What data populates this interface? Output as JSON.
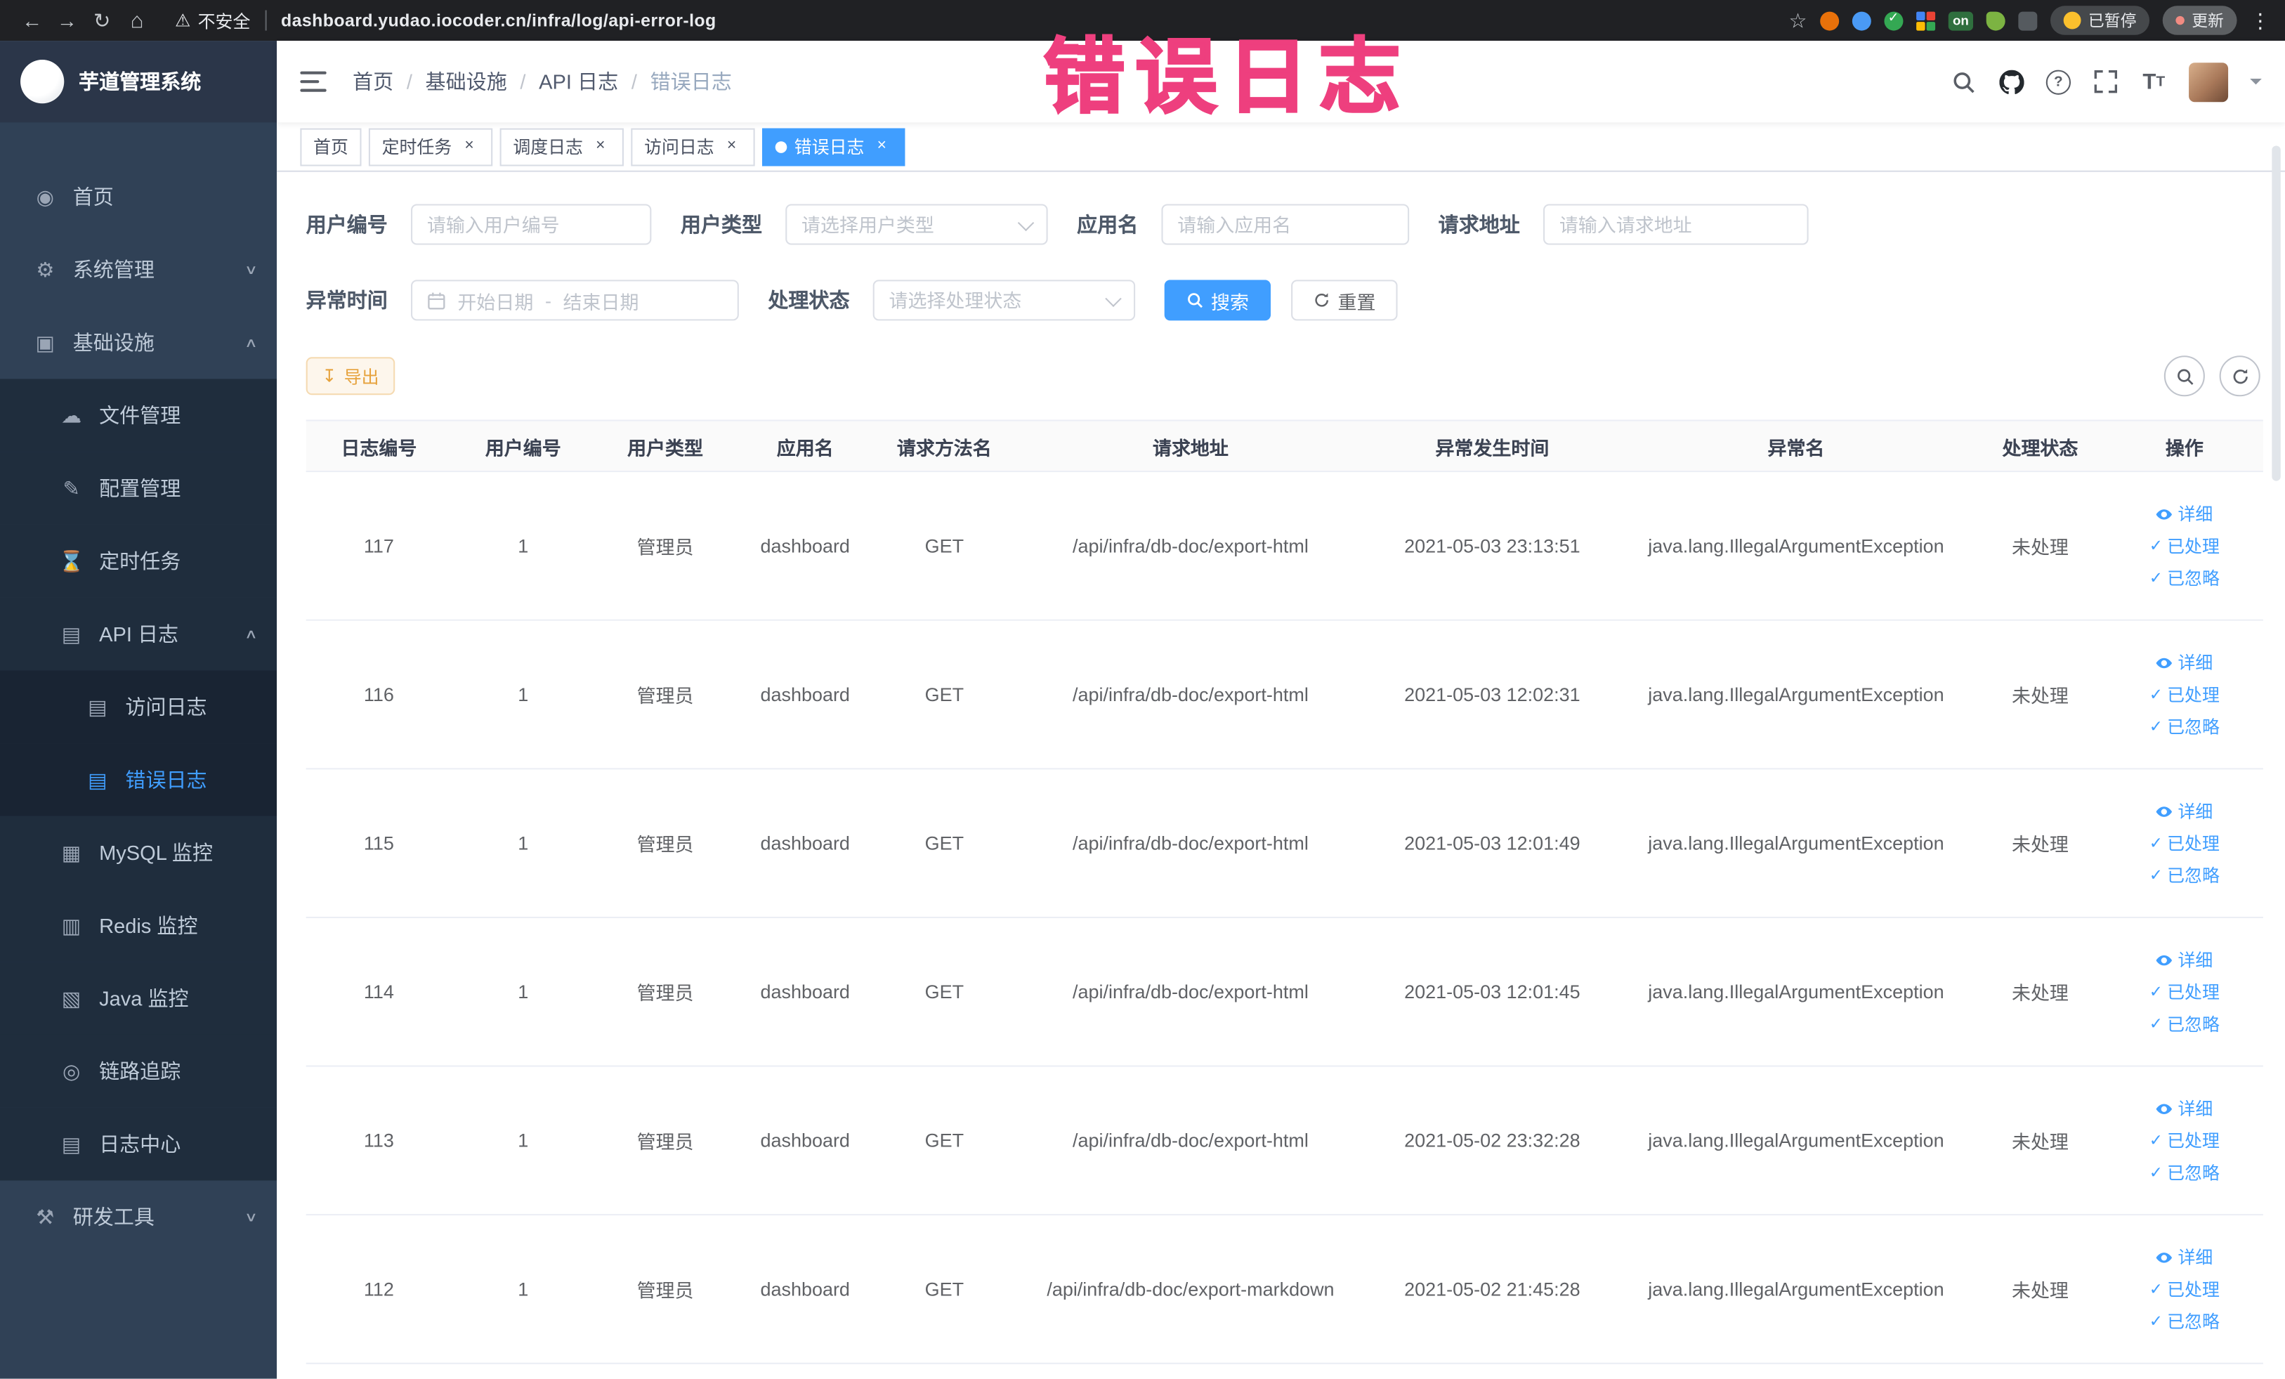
{
  "browser": {
    "security_label": "不安全",
    "url": "dashboard.yudao.iocoder.cn/infra/log/api-error-log",
    "paused_label": "已暂停",
    "update_label": "更新",
    "extension_on_badge": "on"
  },
  "annotation": {
    "text": "错误日志",
    "color": "#ee3f7e"
  },
  "sidebar": {
    "logo_title": "芋道管理系统",
    "menu": [
      {
        "key": "home",
        "label": "首页",
        "icon": "dashboard-icon",
        "level": 0
      },
      {
        "key": "system",
        "label": "系统管理",
        "icon": "gear-icon",
        "level": 0,
        "expand": "down"
      },
      {
        "key": "infra",
        "label": "基础设施",
        "icon": "infra-icon",
        "level": 0,
        "expand": "up"
      },
      {
        "key": "file",
        "label": "文件管理",
        "icon": "file-icon",
        "level": 1
      },
      {
        "key": "config",
        "label": "配置管理",
        "icon": "config-icon",
        "level": 1
      },
      {
        "key": "job",
        "label": "定时任务",
        "icon": "job-icon",
        "level": 1
      },
      {
        "key": "api-log",
        "label": "API 日志",
        "icon": "api-log-icon",
        "level": 1,
        "expand": "up"
      },
      {
        "key": "access-log",
        "label": "访问日志",
        "icon": "access-log-icon",
        "level": 2
      },
      {
        "key": "error-log",
        "label": "错误日志",
        "icon": "error-log-icon",
        "level": 2,
        "active": true
      },
      {
        "key": "mysql",
        "label": "MySQL 监控",
        "icon": "mysql-icon",
        "level": 1
      },
      {
        "key": "redis",
        "label": "Redis 监控",
        "icon": "redis-icon",
        "level": 1
      },
      {
        "key": "java",
        "label": "Java 监控",
        "icon": "java-icon",
        "level": 1
      },
      {
        "key": "trace",
        "label": "链路追踪",
        "icon": "trace-icon",
        "level": 1
      },
      {
        "key": "log-center",
        "label": "日志中心",
        "icon": "log-center-icon",
        "level": 1
      },
      {
        "key": "dev-tools",
        "label": "研发工具",
        "icon": "tools-icon",
        "level": 0,
        "expand": "down"
      }
    ]
  },
  "breadcrumb": [
    "首页",
    "基础设施",
    "API 日志",
    "错误日志"
  ],
  "tabs": [
    {
      "label": "首页",
      "closable": false,
      "active": false
    },
    {
      "label": "定时任务",
      "closable": true,
      "active": false
    },
    {
      "label": "调度日志",
      "closable": true,
      "active": false
    },
    {
      "label": "访问日志",
      "closable": true,
      "active": false
    },
    {
      "label": "错误日志",
      "closable": true,
      "active": true
    }
  ],
  "filters": {
    "user_id_label": "用户编号",
    "user_id_placeholder": "请输入用户编号",
    "user_type_label": "用户类型",
    "user_type_placeholder": "请选择用户类型",
    "app_name_label": "应用名",
    "app_name_placeholder": "请输入应用名",
    "request_url_label": "请求地址",
    "request_url_placeholder": "请输入请求地址",
    "exception_time_label": "异常时间",
    "start_placeholder": "开始日期",
    "range_separator": "-",
    "end_placeholder": "结束日期",
    "process_status_label": "处理状态",
    "process_status_placeholder": "请选择处理状态",
    "search_label": "搜索",
    "reset_label": "重置"
  },
  "toolbar": {
    "export_label": "导出"
  },
  "table": {
    "columns": [
      "日志编号",
      "用户编号",
      "用户类型",
      "应用名",
      "请求方法名",
      "请求地址",
      "异常发生时间",
      "异常名",
      "处理状态",
      "操作"
    ],
    "actions": [
      "详细",
      "已处理",
      "已忽略"
    ],
    "rows": [
      {
        "id": "117",
        "user_id": "1",
        "user_type": "管理员",
        "app_name": "dashboard",
        "method": "GET",
        "url": "/api/infra/db-doc/export-html",
        "time": "2021-05-03 23:13:51",
        "exception": "java.lang.IllegalArgumentException",
        "status": "未处理"
      },
      {
        "id": "116",
        "user_id": "1",
        "user_type": "管理员",
        "app_name": "dashboard",
        "method": "GET",
        "url": "/api/infra/db-doc/export-html",
        "time": "2021-05-03 12:02:31",
        "exception": "java.lang.IllegalArgumentException",
        "status": "未处理"
      },
      {
        "id": "115",
        "user_id": "1",
        "user_type": "管理员",
        "app_name": "dashboard",
        "method": "GET",
        "url": "/api/infra/db-doc/export-html",
        "time": "2021-05-03 12:01:49",
        "exception": "java.lang.IllegalArgumentException",
        "status": "未处理"
      },
      {
        "id": "114",
        "user_id": "1",
        "user_type": "管理员",
        "app_name": "dashboard",
        "method": "GET",
        "url": "/api/infra/db-doc/export-html",
        "time": "2021-05-03 12:01:45",
        "exception": "java.lang.IllegalArgumentException",
        "status": "未处理"
      },
      {
        "id": "113",
        "user_id": "1",
        "user_type": "管理员",
        "app_name": "dashboard",
        "method": "GET",
        "url": "/api/infra/db-doc/export-html",
        "time": "2021-05-02 23:32:28",
        "exception": "java.lang.IllegalArgumentException",
        "status": "未处理"
      },
      {
        "id": "112",
        "user_id": "1",
        "user_type": "管理员",
        "app_name": "dashboard",
        "method": "GET",
        "url": "/api/infra/db-doc/export-markdown",
        "time": "2021-05-02 21:45:28",
        "exception": "java.lang.IllegalArgumentException",
        "status": "未处理"
      }
    ]
  }
}
